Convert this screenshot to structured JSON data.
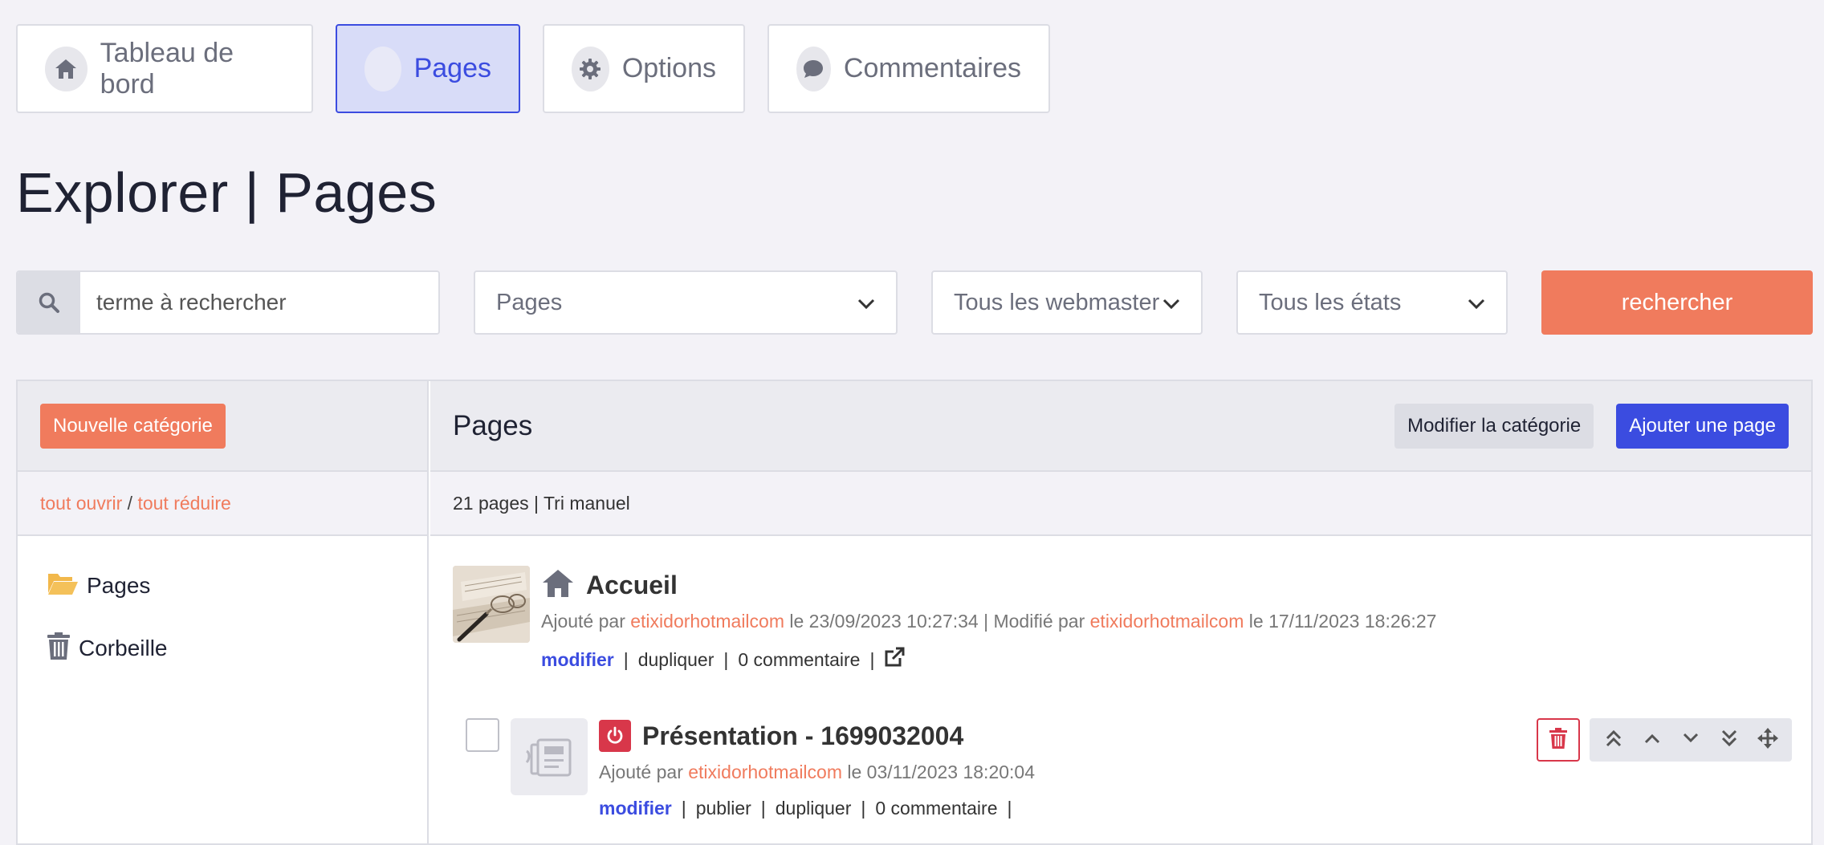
{
  "nav": {
    "tabs": [
      {
        "label": "Tableau de bord",
        "icon": "home-icon"
      },
      {
        "label": "Pages",
        "icon": "circle-icon",
        "active": true
      },
      {
        "label": "Options",
        "icon": "gear-icon"
      },
      {
        "label": "Commentaires",
        "icon": "comment-icon"
      }
    ]
  },
  "page_title": "Explorer | Pages",
  "search": {
    "placeholder": "terme à rechercher",
    "type_select": "Pages",
    "webmaster_select": "Tous les webmaster",
    "state_select": "Tous les états",
    "button_label": "rechercher"
  },
  "sidebar": {
    "new_category_label": "Nouvelle catégorie",
    "open_all": "tout ouvrir",
    "separator": " / ",
    "collapse_all": "tout réduire",
    "items": [
      {
        "label": "Pages",
        "icon": "folder-open-icon"
      },
      {
        "label": "Corbeille",
        "icon": "trash-icon"
      }
    ]
  },
  "main": {
    "title": "Pages",
    "edit_category_label": "Modifier la catégorie",
    "add_page_label": "Ajouter une page",
    "summary": "21 pages | Tri manuel",
    "entries": [
      {
        "title": "Accueil",
        "added_prefix": "Ajouté par ",
        "added_by": "etixidorhotmailcom",
        "added_date": " le 23/09/2023 10:27:34 | Modifié par ",
        "modified_by": "etixidorhotmailcom",
        "modified_date": " le 17/11/2023 18:26:27",
        "action_edit": "modifier",
        "action_duplicate": "dupliquer",
        "action_comments": "0 commentaire",
        "sep": "|"
      },
      {
        "title": "Présentation - 1699032004",
        "added_prefix": "Ajouté par ",
        "added_by": "etixidorhotmailcom",
        "added_date": " le 03/11/2023 18:20:04",
        "action_edit": "modifier",
        "action_publish": "publier",
        "action_duplicate": "dupliquer",
        "action_comments": "0 commentaire",
        "sep": "|"
      }
    ]
  },
  "colors": {
    "accent_blue": "#3b4ce0",
    "accent_orange": "#f07b5d",
    "danger_red": "#d8374a"
  }
}
